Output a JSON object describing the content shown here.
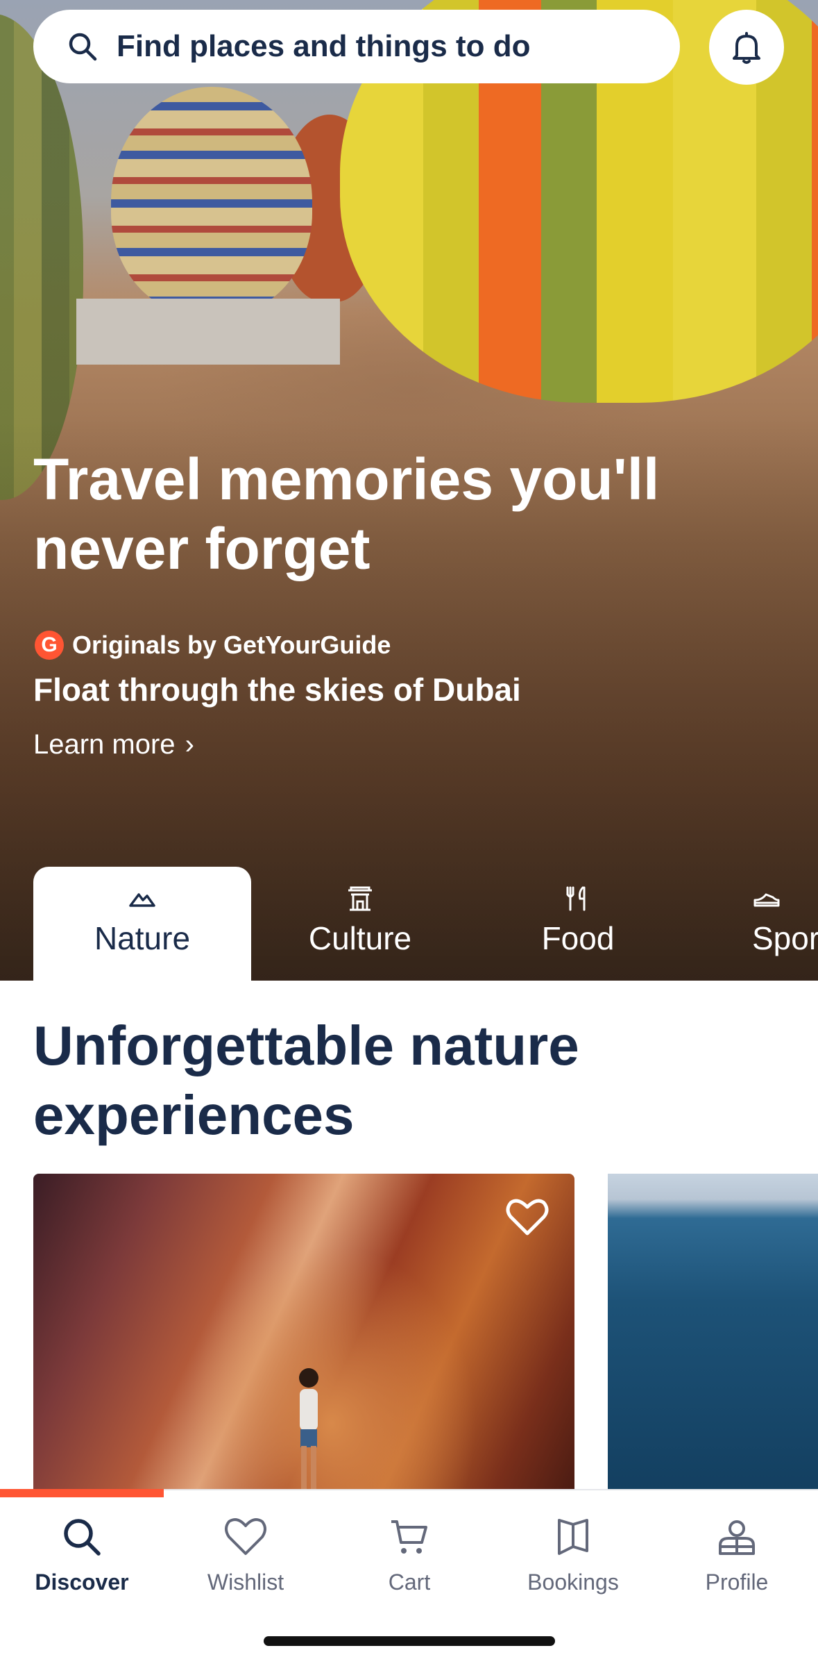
{
  "search": {
    "placeholder": "Find places and things to do",
    "icon": "search-icon"
  },
  "notifications": {
    "icon": "bell-icon"
  },
  "hero": {
    "title": "Travel memories you'll never forget",
    "badge_letter": "G",
    "originals_label": "Originals by GetYourGuide",
    "subtitle": "Float through the skies of Dubai",
    "cta": "Learn more"
  },
  "categories": [
    {
      "label": "Nature",
      "icon": "mountain-icon",
      "active": true
    },
    {
      "label": "Culture",
      "icon": "temple-icon",
      "active": false
    },
    {
      "label": "Food",
      "icon": "cutlery-icon",
      "active": false
    },
    {
      "label": "Spor",
      "icon": "sports-icon",
      "active": false
    }
  ],
  "section": {
    "title": "Unforgettable nature experiences"
  },
  "tabbar": [
    {
      "label": "Discover",
      "icon": "search-icon",
      "active": true
    },
    {
      "label": "Wishlist",
      "icon": "heart-icon",
      "active": false
    },
    {
      "label": "Cart",
      "icon": "cart-icon",
      "active": false
    },
    {
      "label": "Bookings",
      "icon": "bookmark-icon",
      "active": false
    },
    {
      "label": "Profile",
      "icon": "profile-icon",
      "active": false
    }
  ],
  "colors": {
    "brand": "#ff5533",
    "navy": "#1a2b49",
    "inactive": "#63687a"
  }
}
